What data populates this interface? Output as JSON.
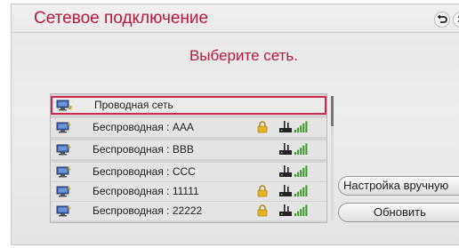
{
  "header": {
    "title": "Сетевое подключение",
    "back_icon": "back-icon",
    "close_icon": "close-icon"
  },
  "subtitle": "Выберите сеть.",
  "networks": [
    {
      "label": "Проводная сеть",
      "type": "wired",
      "secured": false,
      "selected": true,
      "signal_bars": 0
    },
    {
      "label": "Беспроводная : AAA",
      "type": "wireless",
      "secured": true,
      "selected": false,
      "signal_bars": 5
    },
    {
      "label": "Беспроводная : BBB",
      "type": "wireless",
      "secured": false,
      "selected": false,
      "signal_bars": 5
    },
    {
      "label": "Беспроводная : CCC",
      "type": "wireless",
      "secured": false,
      "selected": false,
      "signal_bars": 5
    },
    {
      "label": "Беспроводная : 11111",
      "type": "wireless",
      "secured": true,
      "selected": false,
      "signal_bars": 5
    },
    {
      "label": "Беспроводная : 22222",
      "type": "wireless",
      "secured": true,
      "selected": false,
      "signal_bars": 5
    }
  ],
  "buttons": {
    "manual_label": "Настройка вручную",
    "refresh_label": "Обновить"
  },
  "colors": {
    "accent": "#b8193e",
    "selection_border": "#d0294f",
    "signal_green": "#3a9a2a"
  }
}
